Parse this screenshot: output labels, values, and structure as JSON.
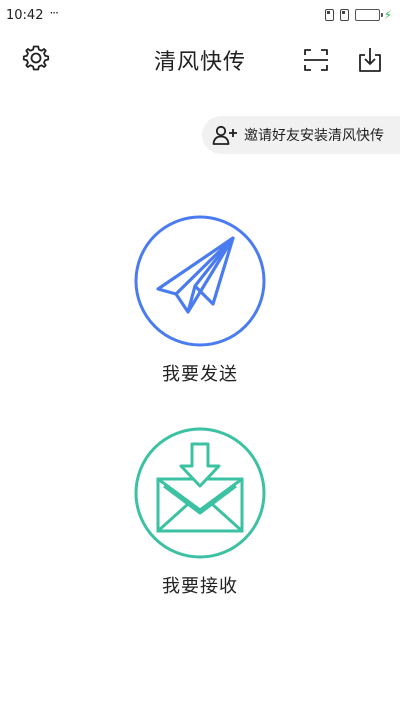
{
  "status_bar": {
    "time": "10:42",
    "dots": "···",
    "battery_level": 1.0,
    "battery_color": "#3dbb5a",
    "icons": [
      "sim-icon",
      "sim-icon",
      "battery-icon",
      "charging-icon"
    ]
  },
  "app_bar": {
    "title": "清风快传",
    "icons": [
      "gear-icon",
      "scan-icon",
      "download-icon"
    ]
  },
  "invite": {
    "label": "邀请好友安装清风快传",
    "icon": "add-user-icon"
  },
  "actions": {
    "send": {
      "label": "我要发送",
      "icon": "paper-plane-icon",
      "color": "#4a7cf0"
    },
    "receive": {
      "label": "我要接收",
      "icon": "envelope-download-icon",
      "color": "#3cc2a2"
    }
  }
}
